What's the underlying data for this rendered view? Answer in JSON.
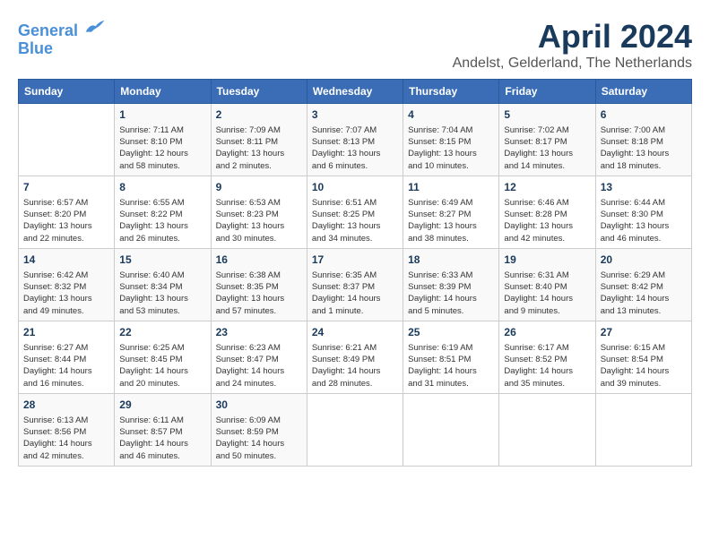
{
  "logo": {
    "line1": "General",
    "line2": "Blue"
  },
  "title": "April 2024",
  "subtitle": "Andelst, Gelderland, The Netherlands",
  "days_header": [
    "Sunday",
    "Monday",
    "Tuesday",
    "Wednesday",
    "Thursday",
    "Friday",
    "Saturday"
  ],
  "weeks": [
    [
      {
        "day": "",
        "info": ""
      },
      {
        "day": "1",
        "info": "Sunrise: 7:11 AM\nSunset: 8:10 PM\nDaylight: 12 hours\nand 58 minutes."
      },
      {
        "day": "2",
        "info": "Sunrise: 7:09 AM\nSunset: 8:11 PM\nDaylight: 13 hours\nand 2 minutes."
      },
      {
        "day": "3",
        "info": "Sunrise: 7:07 AM\nSunset: 8:13 PM\nDaylight: 13 hours\nand 6 minutes."
      },
      {
        "day": "4",
        "info": "Sunrise: 7:04 AM\nSunset: 8:15 PM\nDaylight: 13 hours\nand 10 minutes."
      },
      {
        "day": "5",
        "info": "Sunrise: 7:02 AM\nSunset: 8:17 PM\nDaylight: 13 hours\nand 14 minutes."
      },
      {
        "day": "6",
        "info": "Sunrise: 7:00 AM\nSunset: 8:18 PM\nDaylight: 13 hours\nand 18 minutes."
      }
    ],
    [
      {
        "day": "7",
        "info": "Sunrise: 6:57 AM\nSunset: 8:20 PM\nDaylight: 13 hours\nand 22 minutes."
      },
      {
        "day": "8",
        "info": "Sunrise: 6:55 AM\nSunset: 8:22 PM\nDaylight: 13 hours\nand 26 minutes."
      },
      {
        "day": "9",
        "info": "Sunrise: 6:53 AM\nSunset: 8:23 PM\nDaylight: 13 hours\nand 30 minutes."
      },
      {
        "day": "10",
        "info": "Sunrise: 6:51 AM\nSunset: 8:25 PM\nDaylight: 13 hours\nand 34 minutes."
      },
      {
        "day": "11",
        "info": "Sunrise: 6:49 AM\nSunset: 8:27 PM\nDaylight: 13 hours\nand 38 minutes."
      },
      {
        "day": "12",
        "info": "Sunrise: 6:46 AM\nSunset: 8:28 PM\nDaylight: 13 hours\nand 42 minutes."
      },
      {
        "day": "13",
        "info": "Sunrise: 6:44 AM\nSunset: 8:30 PM\nDaylight: 13 hours\nand 46 minutes."
      }
    ],
    [
      {
        "day": "14",
        "info": "Sunrise: 6:42 AM\nSunset: 8:32 PM\nDaylight: 13 hours\nand 49 minutes."
      },
      {
        "day": "15",
        "info": "Sunrise: 6:40 AM\nSunset: 8:34 PM\nDaylight: 13 hours\nand 53 minutes."
      },
      {
        "day": "16",
        "info": "Sunrise: 6:38 AM\nSunset: 8:35 PM\nDaylight: 13 hours\nand 57 minutes."
      },
      {
        "day": "17",
        "info": "Sunrise: 6:35 AM\nSunset: 8:37 PM\nDaylight: 14 hours\nand 1 minute."
      },
      {
        "day": "18",
        "info": "Sunrise: 6:33 AM\nSunset: 8:39 PM\nDaylight: 14 hours\nand 5 minutes."
      },
      {
        "day": "19",
        "info": "Sunrise: 6:31 AM\nSunset: 8:40 PM\nDaylight: 14 hours\nand 9 minutes."
      },
      {
        "day": "20",
        "info": "Sunrise: 6:29 AM\nSunset: 8:42 PM\nDaylight: 14 hours\nand 13 minutes."
      }
    ],
    [
      {
        "day": "21",
        "info": "Sunrise: 6:27 AM\nSunset: 8:44 PM\nDaylight: 14 hours\nand 16 minutes."
      },
      {
        "day": "22",
        "info": "Sunrise: 6:25 AM\nSunset: 8:45 PM\nDaylight: 14 hours\nand 20 minutes."
      },
      {
        "day": "23",
        "info": "Sunrise: 6:23 AM\nSunset: 8:47 PM\nDaylight: 14 hours\nand 24 minutes."
      },
      {
        "day": "24",
        "info": "Sunrise: 6:21 AM\nSunset: 8:49 PM\nDaylight: 14 hours\nand 28 minutes."
      },
      {
        "day": "25",
        "info": "Sunrise: 6:19 AM\nSunset: 8:51 PM\nDaylight: 14 hours\nand 31 minutes."
      },
      {
        "day": "26",
        "info": "Sunrise: 6:17 AM\nSunset: 8:52 PM\nDaylight: 14 hours\nand 35 minutes."
      },
      {
        "day": "27",
        "info": "Sunrise: 6:15 AM\nSunset: 8:54 PM\nDaylight: 14 hours\nand 39 minutes."
      }
    ],
    [
      {
        "day": "28",
        "info": "Sunrise: 6:13 AM\nSunset: 8:56 PM\nDaylight: 14 hours\nand 42 minutes."
      },
      {
        "day": "29",
        "info": "Sunrise: 6:11 AM\nSunset: 8:57 PM\nDaylight: 14 hours\nand 46 minutes."
      },
      {
        "day": "30",
        "info": "Sunrise: 6:09 AM\nSunset: 8:59 PM\nDaylight: 14 hours\nand 50 minutes."
      },
      {
        "day": "",
        "info": ""
      },
      {
        "day": "",
        "info": ""
      },
      {
        "day": "",
        "info": ""
      },
      {
        "day": "",
        "info": ""
      }
    ]
  ]
}
